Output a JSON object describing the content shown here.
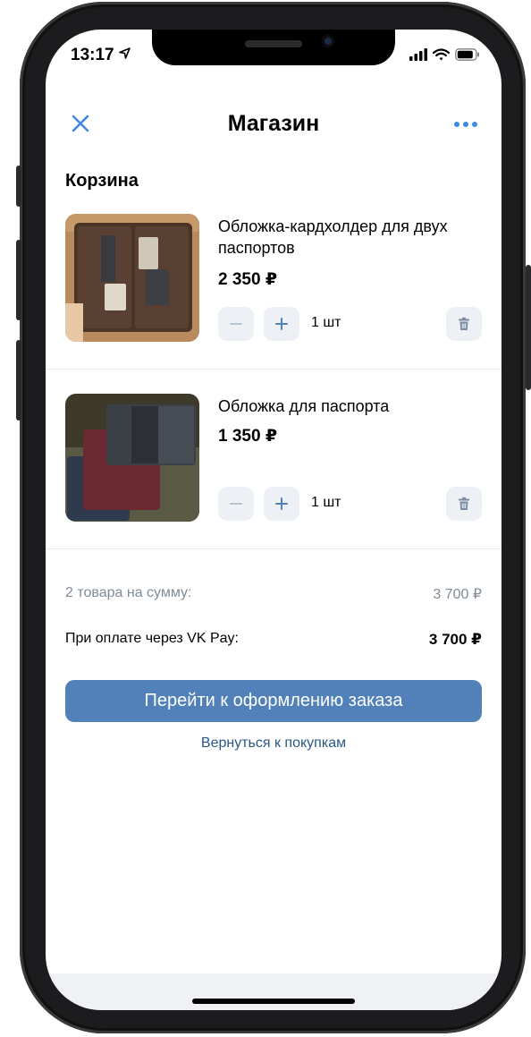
{
  "status_bar": {
    "time": "13:17"
  },
  "header": {
    "title": "Магазин"
  },
  "cart": {
    "title": "Корзина",
    "items": [
      {
        "name": "Обложка-кардхолдер для двух паспортов",
        "price": "2 350 ₽",
        "quantity": "1 шт"
      },
      {
        "name": "Обложка для паспорта",
        "price": "1 350 ₽",
        "quantity": "1 шт"
      }
    ]
  },
  "summary": {
    "items_label": "2 товара на сумму:",
    "items_total": "3 700 ₽",
    "vkpay_label": "При оплате через VK Pay:",
    "vkpay_total": "3 700 ₽"
  },
  "actions": {
    "checkout_label": "Перейти к оформлению заказа",
    "back_label": "Вернуться к покупкам"
  },
  "colors": {
    "accent": "#5181b8",
    "link": "#2a5885",
    "muted": "#818c99",
    "button_bg": "#edf0f5"
  }
}
